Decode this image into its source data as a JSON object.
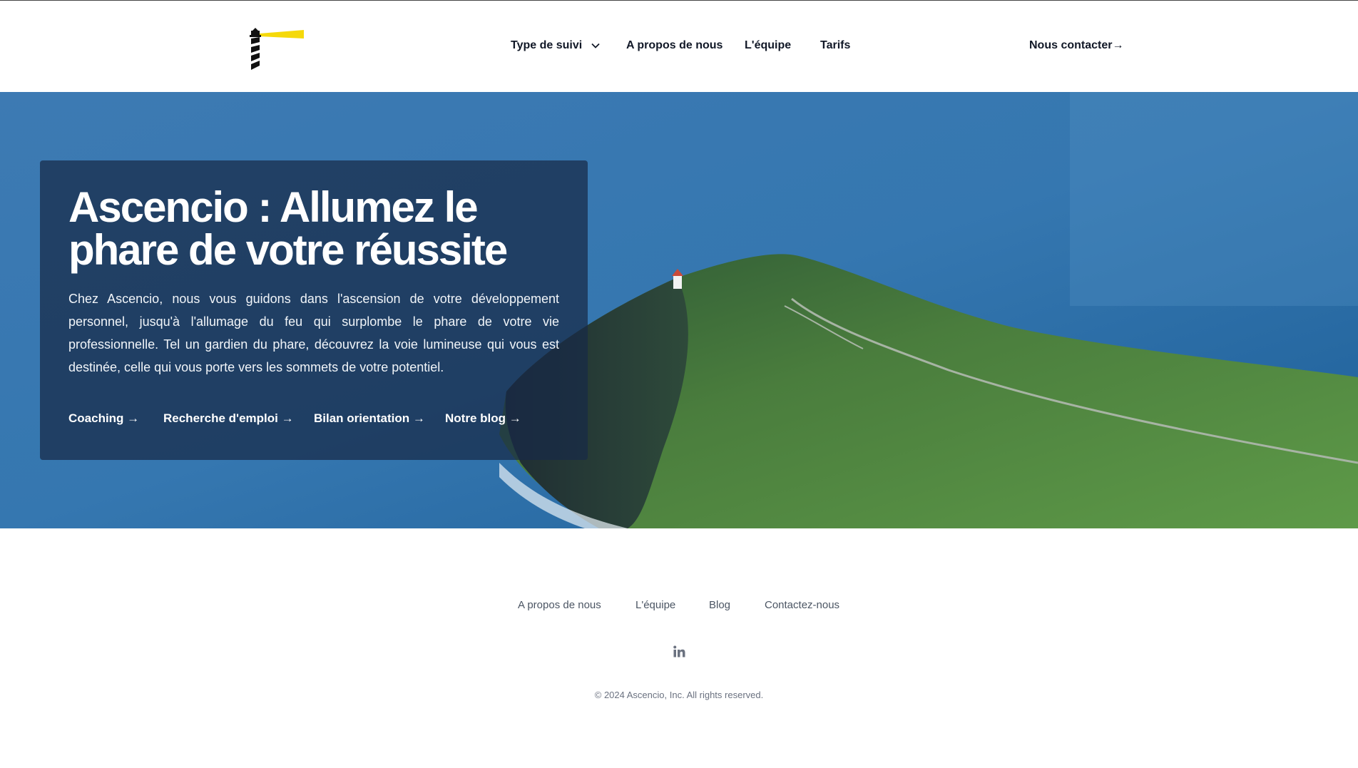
{
  "header": {
    "nav": [
      {
        "label": "Type de suivi",
        "has_dropdown": true
      },
      {
        "label": "A propos de nous"
      },
      {
        "label": "L'équipe"
      },
      {
        "label": "Tarifs"
      }
    ],
    "contact_label": "Nous contacter",
    "contact_arrow": "→"
  },
  "hero": {
    "title_line1": "Ascencio : Allumez le",
    "title_line2": "phare de votre réussite",
    "description": "Chez Ascencio, nous vous guidons dans l'ascension de votre développement personnel, jusqu'à l'allumage du feu qui surplombe le phare de votre vie professionnelle. Tel un gardien du phare, découvrez la voie lumineuse qui vous est destinée, celle qui vous porte vers les sommets de votre potentiel.",
    "links": [
      {
        "label": "Coaching →"
      },
      {
        "label": "Recherche d'emploi →"
      },
      {
        "label": "Bilan orientation →"
      },
      {
        "label": "Notre blog →"
      }
    ]
  },
  "footer": {
    "links": [
      {
        "label": "A propos de nous"
      },
      {
        "label": "L'équipe"
      },
      {
        "label": "Blog"
      },
      {
        "label": "Contactez-nous"
      }
    ],
    "social_icon": "linkedin-icon",
    "copyright": "© 2024 Ascencio, Inc. All rights reserved."
  },
  "colors": {
    "accent_yellow": "#f5d90a",
    "text_dark": "#111827",
    "footer_text": "#4b5563"
  }
}
